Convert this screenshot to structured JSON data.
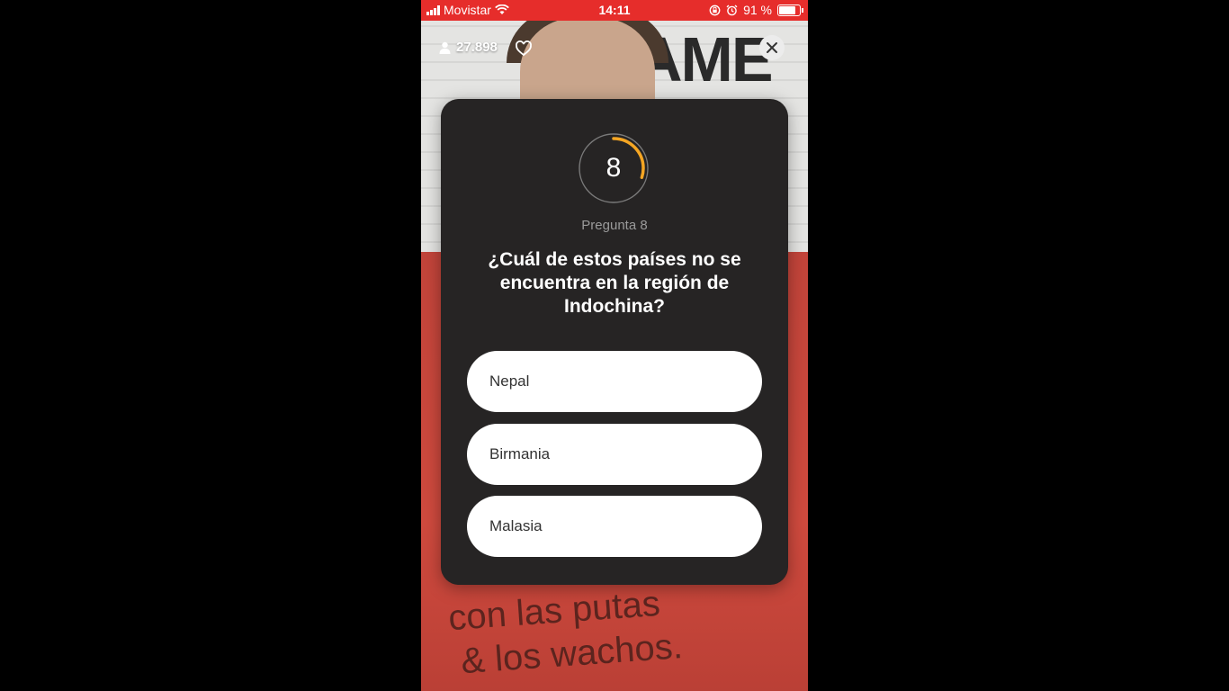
{
  "status_bar": {
    "carrier": "Movistar",
    "time": "14:11",
    "battery_text": "91 %",
    "battery_level": 0.91,
    "color": "#e62d2b"
  },
  "overlay": {
    "viewer_count": "27.898",
    "icons": [
      "user-icon",
      "heart-icon",
      "close-icon"
    ]
  },
  "background": {
    "sign_text": "AME",
    "shirt_line_1": "con las putas",
    "shirt_line_2": "& los wachos."
  },
  "card": {
    "timer_value": "8",
    "timer_progress": 0.3,
    "accent_color": "#f5a623",
    "question_label": "Pregunta 8",
    "question": "¿Cuál de estos países no se encuentra en la región de Indochina?",
    "answers": [
      {
        "label": "Nepal"
      },
      {
        "label": "Birmania"
      },
      {
        "label": "Malasia"
      }
    ]
  }
}
